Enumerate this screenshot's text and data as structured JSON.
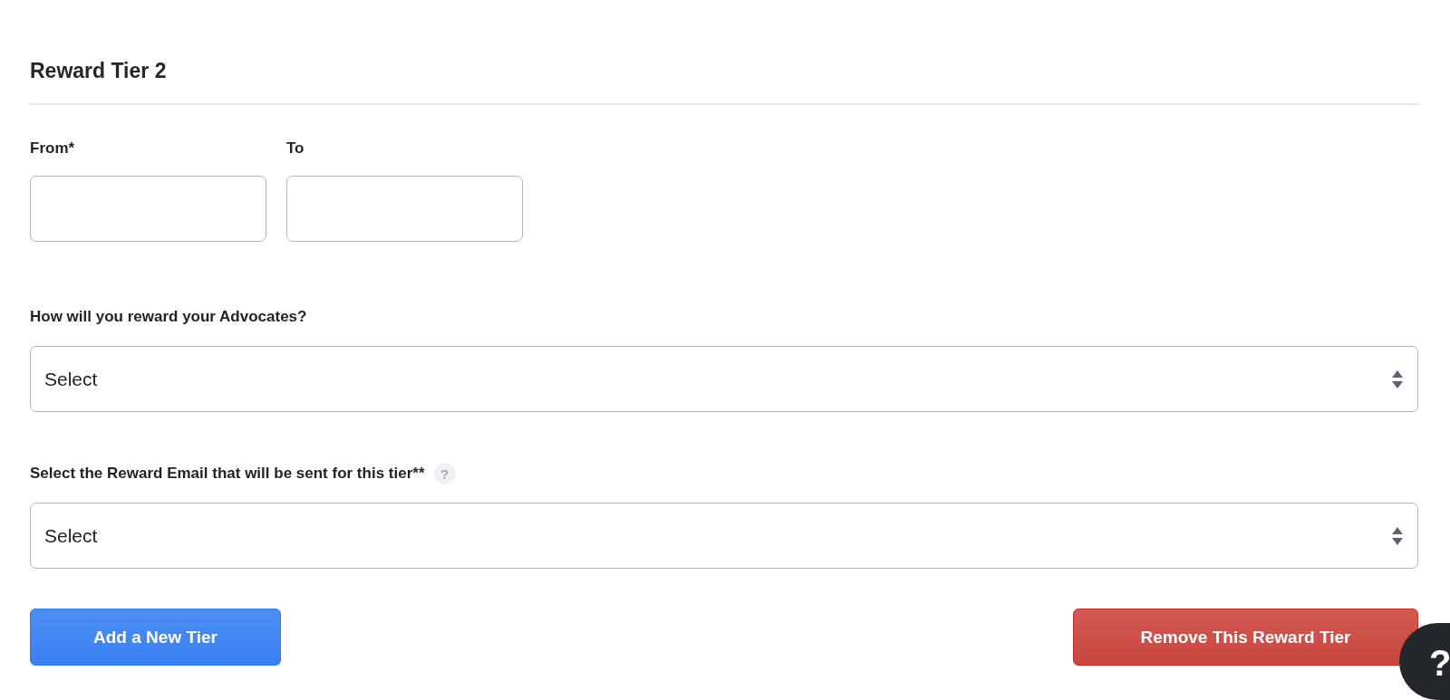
{
  "section": {
    "title": "Reward Tier 2"
  },
  "range_fields": [
    {
      "label": "From*"
    },
    {
      "label": "To"
    }
  ],
  "selects": [
    {
      "label": "How will you reward your Advocates?",
      "value": "Select",
      "help": false
    },
    {
      "label": "Select the Reward Email that will be sent for this tier**",
      "value": "Select",
      "help": true,
      "help_text": "?"
    }
  ],
  "buttons": [
    {
      "kind": "primary",
      "label": "Add a New Tier"
    },
    {
      "kind": "danger",
      "label": "Remove This Reward Tier"
    }
  ],
  "help_bubble": {
    "label": "?"
  }
}
